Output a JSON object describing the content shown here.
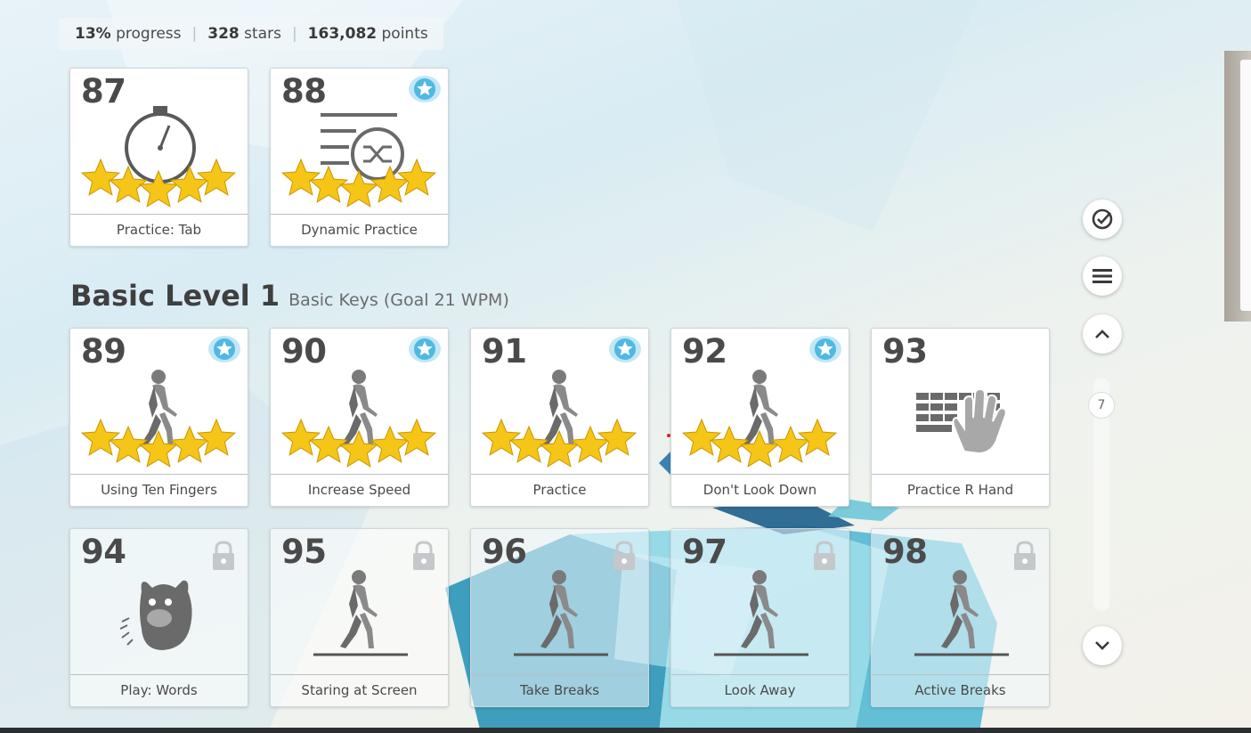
{
  "stats": {
    "progress_value": "13%",
    "progress_label": "progress",
    "stars_value": "328",
    "stars_label": "stars",
    "points_value": "163,082",
    "points_label": "points"
  },
  "cards_top": [
    {
      "number": "87",
      "label": "Practice: Tab",
      "stars": 5,
      "icon": "stopwatch-icon",
      "badge": false
    },
    {
      "number": "88",
      "label": "Dynamic Practice",
      "stars": 5,
      "icon": "shuffle-text-icon",
      "badge": true
    }
  ],
  "section": {
    "title": "Basic Level 1",
    "subtitle": "Basic Keys (Goal 21 WPM)"
  },
  "cards_row1": [
    {
      "number": "89",
      "label": "Using Ten Fingers",
      "stars": 5,
      "icon": "walking-person-icon",
      "badge": true
    },
    {
      "number": "90",
      "label": "Increase Speed",
      "stars": 5,
      "icon": "walking-person-icon",
      "badge": true
    },
    {
      "number": "91",
      "label": "Practice",
      "stars": 5,
      "icon": "walking-person-icon",
      "badge": true
    },
    {
      "number": "92",
      "label": "Don't Look Down",
      "stars": 5,
      "icon": "walking-person-icon",
      "badge": true
    },
    {
      "number": "93",
      "label": "Practice R Hand",
      "stars": 0,
      "icon": "keyboard-hand-icon",
      "badge": false
    }
  ],
  "cards_row2": [
    {
      "number": "94",
      "label": "Play: Words",
      "locked": true,
      "icon": "monster-game-icon"
    },
    {
      "number": "95",
      "label": "Staring at Screen",
      "locked": true,
      "icon": "walking-person-icon"
    },
    {
      "number": "96",
      "label": "Take Breaks",
      "locked": true,
      "icon": "walking-person-icon"
    },
    {
      "number": "97",
      "label": "Look Away",
      "locked": true,
      "icon": "walking-person-icon"
    },
    {
      "number": "98",
      "label": "Active Breaks",
      "locked": true,
      "icon": "walking-person-icon"
    }
  ],
  "sidebar": {
    "buttons": [
      "check-circle-icon",
      "menu-icon",
      "chevron-up-icon",
      "chevron-down-icon"
    ],
    "scroll_position": "7"
  },
  "colors": {
    "star": "#f5c518",
    "badge": "#4fb9e3",
    "text": "#4a4a4a"
  }
}
